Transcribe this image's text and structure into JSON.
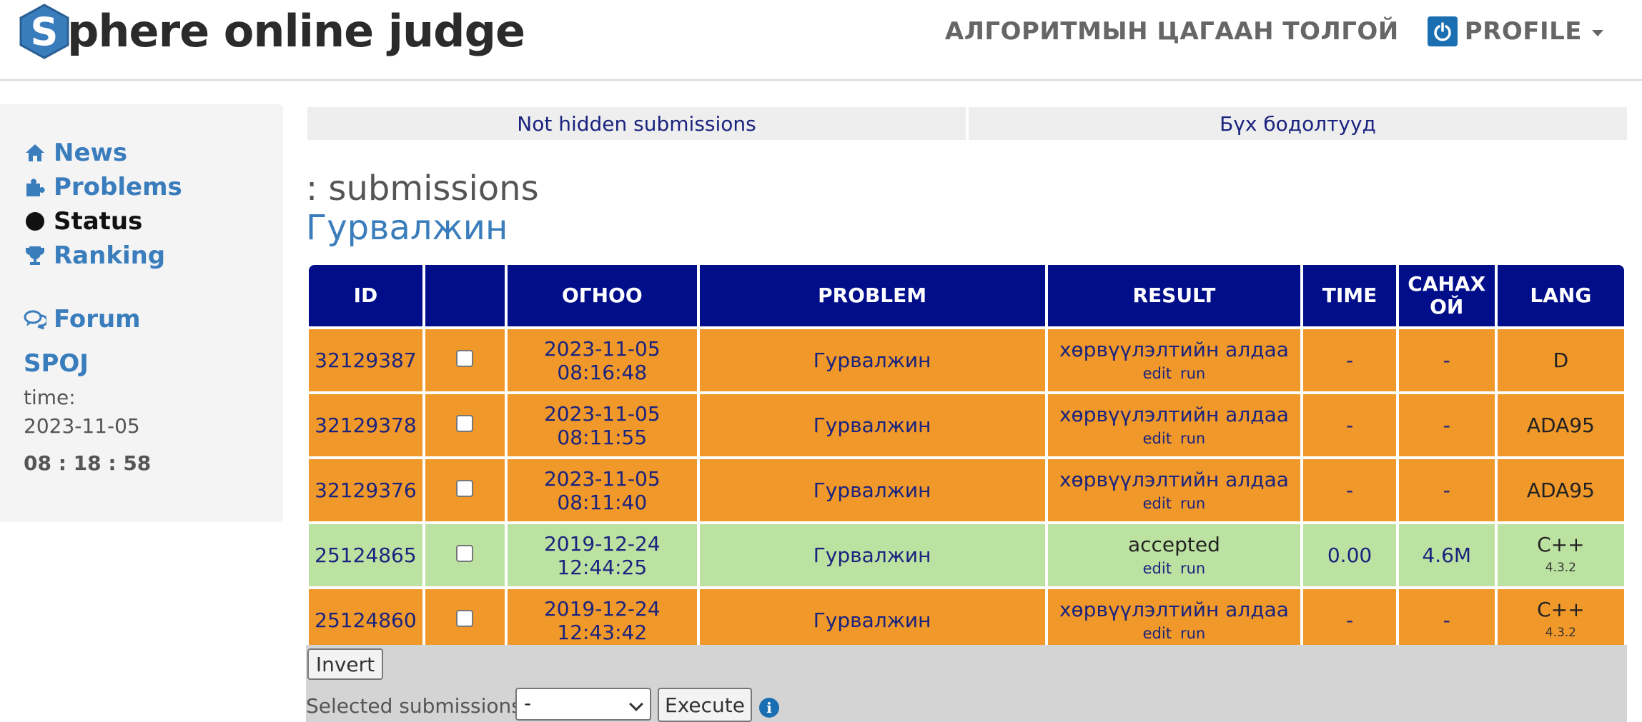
{
  "header": {
    "logo_text": "phere online judge",
    "logo_letter": "S",
    "nav_link": "АЛГОРИТМЫН ЦАГААН ТОЛГОЙ",
    "profile_label": "PROFILE"
  },
  "sidebar": {
    "items": [
      {
        "label": "News",
        "icon": "home-icon"
      },
      {
        "label": "Problems",
        "icon": "puzzle-icon"
      },
      {
        "label": "Status",
        "icon": "circle-icon"
      },
      {
        "label": "Ranking",
        "icon": "trophy-icon"
      },
      {
        "label": "Forum",
        "icon": "comments-icon"
      }
    ],
    "spoj_title": "SPOJ",
    "time_label": "time:",
    "date": "2023-11-05",
    "clock": "08 : 18 : 58"
  },
  "tabs": [
    "Not hidden submissions",
    "Бүх бодолтууд"
  ],
  "page": {
    "title": ": submissions",
    "subtitle": "Гурвалжин"
  },
  "table": {
    "headers": [
      "ID",
      "",
      "ОГНОО",
      "PROBLEM",
      "RESULT",
      "TIME",
      "САНАХ ОЙ",
      "LANG"
    ],
    "rows": [
      {
        "id": "32129387",
        "date": "2023-11-05 08:16:48",
        "problem": "Гурвалжин",
        "result": "хөрвүүлэлтийн алдаа",
        "edit": "edit",
        "run": "run",
        "time": "-",
        "mem": "-",
        "lang": "D",
        "lang_ver": "",
        "status": "error"
      },
      {
        "id": "32129378",
        "date": "2023-11-05 08:11:55",
        "problem": "Гурвалжин",
        "result": "хөрвүүлэлтийн алдаа",
        "edit": "edit",
        "run": "run",
        "time": "-",
        "mem": "-",
        "lang": "ADA95",
        "lang_ver": "",
        "status": "error"
      },
      {
        "id": "32129376",
        "date": "2023-11-05 08:11:40",
        "problem": "Гурвалжин",
        "result": "хөрвүүлэлтийн алдаа",
        "edit": "edit",
        "run": "run",
        "time": "-",
        "mem": "-",
        "lang": "ADA95",
        "lang_ver": "",
        "status": "error"
      },
      {
        "id": "25124865",
        "date": "2019-12-24 12:44:25",
        "problem": "Гурвалжин",
        "result": "accepted",
        "edit": "edit",
        "run": "run",
        "time": "0.00",
        "mem": "4.6M",
        "lang": "C++",
        "lang_ver": "4.3.2",
        "status": "accepted"
      },
      {
        "id": "25124860",
        "date": "2019-12-24 12:43:42",
        "problem": "Гурвалжин",
        "result": "хөрвүүлэлтийн алдаа",
        "edit": "edit",
        "run": "run",
        "time": "-",
        "mem": "-",
        "lang": "C++",
        "lang_ver": "4.3.2",
        "status": "error"
      }
    ]
  },
  "footer": {
    "invert_label": "Invert",
    "selected_label": "Selected submissions:",
    "select_value": "-",
    "execute_label": "Execute"
  },
  "colors": {
    "header_row": "#000e8a",
    "error_row": "#f0982a",
    "accepted_row": "#bce2a2",
    "link": "#3a7dbd"
  }
}
